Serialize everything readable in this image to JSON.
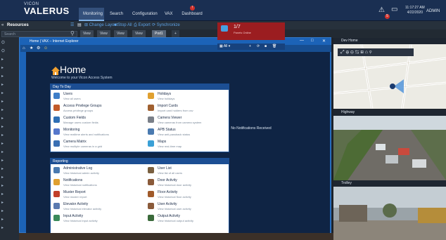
{
  "header": {
    "logo_small": "VICON",
    "logo_main": "VALERUS",
    "tabs": [
      {
        "label": "Monitoring",
        "active": true
      },
      {
        "label": "Search",
        "active": false
      },
      {
        "label": "Configuration",
        "active": false
      },
      {
        "label": "VAX",
        "active": false
      },
      {
        "label": "Dashboard",
        "active": false
      }
    ],
    "dashboard_alert": "!",
    "notification_count": "5",
    "time": "11:17:27 AM",
    "date": "4/22/2020",
    "user": "ADMIN"
  },
  "toolbar": {
    "resources_label": "Resources",
    "change_layout": "Change Layout",
    "stop_all": "Stop All",
    "export": "Export",
    "synchronize": "Synchronize",
    "search_placeholder": "Search",
    "view_tabs": [
      "View",
      "View",
      "View",
      "View",
      "Pod1"
    ],
    "add_tab": "+"
  },
  "ie": {
    "title": "Home | VAX – Internet Explorer",
    "home_title": "Home",
    "home_subtitle": "Welcome to your Vicon Access System",
    "day_to_day": {
      "header": "Day To Day",
      "items": [
        {
          "title": "Users",
          "desc": "View all users",
          "color": "#3e7ec9"
        },
        {
          "title": "Holidays",
          "desc": "View holidays",
          "color": "#e0a030"
        },
        {
          "title": "Access Privilege Groups",
          "desc": "Access privilege groups",
          "color": "#c25a2a"
        },
        {
          "title": "Import Cards",
          "desc": "Import card holders from csv",
          "color": "#a06030"
        },
        {
          "title": "Custom Fields",
          "desc": "Manage users custom fields",
          "color": "#2e6fb6"
        },
        {
          "title": "Camera Viewer",
          "desc": "View cameras from camera system",
          "color": "#7a7f88"
        },
        {
          "title": "Monitoring",
          "desc": "View realtime alerts and notifications",
          "color": "#5577cc"
        },
        {
          "title": "APB Status",
          "desc": "View anti-passback status",
          "color": "#4a7ab0"
        },
        {
          "title": "Camera Matrix",
          "desc": "View multiple cameras in a grid",
          "color": "#3a6fb3"
        },
        {
          "title": "Maps",
          "desc": "View real-time map",
          "color": "#3aa0d6"
        }
      ]
    },
    "reporting": {
      "header": "Reporting",
      "items": [
        {
          "title": "Administrative Log",
          "desc": "View historical admin activity",
          "color": "#4a7ab0"
        },
        {
          "title": "User List",
          "desc": "View list of all users",
          "color": "#7a6040"
        },
        {
          "title": "Notifications",
          "desc": "View historical notifications",
          "color": "#e0a030"
        },
        {
          "title": "Door Activity",
          "desc": "View historical door activity",
          "color": "#8a5a3a"
        },
        {
          "title": "Muster Report",
          "desc": "View muster report",
          "color": "#c2402a"
        },
        {
          "title": "Floor Activity",
          "desc": "View historical floor activity",
          "color": "#a05a2a"
        },
        {
          "title": "Elevator Activity",
          "desc": "View historical elevator activity",
          "color": "#5a7ab0"
        },
        {
          "title": "User Activity",
          "desc": "View historical user activity",
          "color": "#8a5a3a"
        },
        {
          "title": "Input Activity",
          "desc": "View historical input activity",
          "color": "#3a8a5a"
        },
        {
          "title": "Output Activity",
          "desc": "View historical output activity",
          "color": "#3a6a3a"
        }
      ]
    },
    "alarm": {
      "count": "1/7",
      "label": "Panels Online"
    },
    "notif_filter": "All",
    "no_notifications": "No Notifications Received"
  },
  "panes": {
    "map_title": "Dev Home",
    "cam1_title": "Highway",
    "cam2_title": "Trolley"
  }
}
